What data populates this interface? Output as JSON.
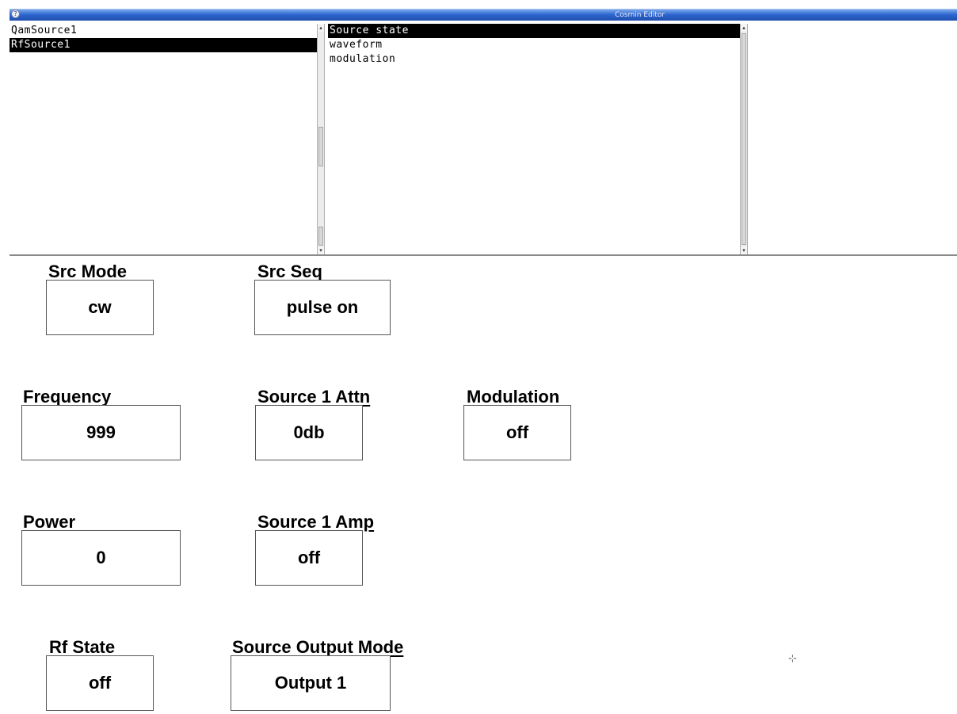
{
  "window": {
    "title": "Cosmin Editor"
  },
  "sources_list": {
    "items": [
      "QamSource1",
      "RfSource1"
    ],
    "selected_index": 1
  },
  "categories_list": {
    "items": [
      "Source state",
      "waveform",
      "modulation"
    ],
    "selected_index": 0
  },
  "fields": {
    "src_mode": {
      "label": "Src Mode",
      "value": "cw"
    },
    "src_seq": {
      "label": "Src Seq",
      "value": "pulse on"
    },
    "frequency": {
      "label": "Frequency",
      "value": "999"
    },
    "source1_attn": {
      "label": "Source 1 Attn",
      "value": "0db"
    },
    "modulation": {
      "label": "Modulation",
      "value": "off"
    },
    "power": {
      "label": "Power",
      "value": "0"
    },
    "source1_amp": {
      "label": "Source 1 Amp",
      "value": "off"
    },
    "rf_state": {
      "label": "Rf State",
      "value": "off"
    },
    "source_output_mode": {
      "label": "Source Output Mode",
      "value": "Output 1"
    }
  },
  "icons": {
    "window_menu": "window-menu-icon",
    "scroll_up": "scroll-up-arrow-icon",
    "scroll_down": "scroll-down-arrow-icon",
    "mouse_cursor": "crosshair-cursor-icon"
  },
  "colors": {
    "titlebar": "#2f67cf",
    "selection_bg": "#000000",
    "selection_fg": "#ffffff"
  }
}
